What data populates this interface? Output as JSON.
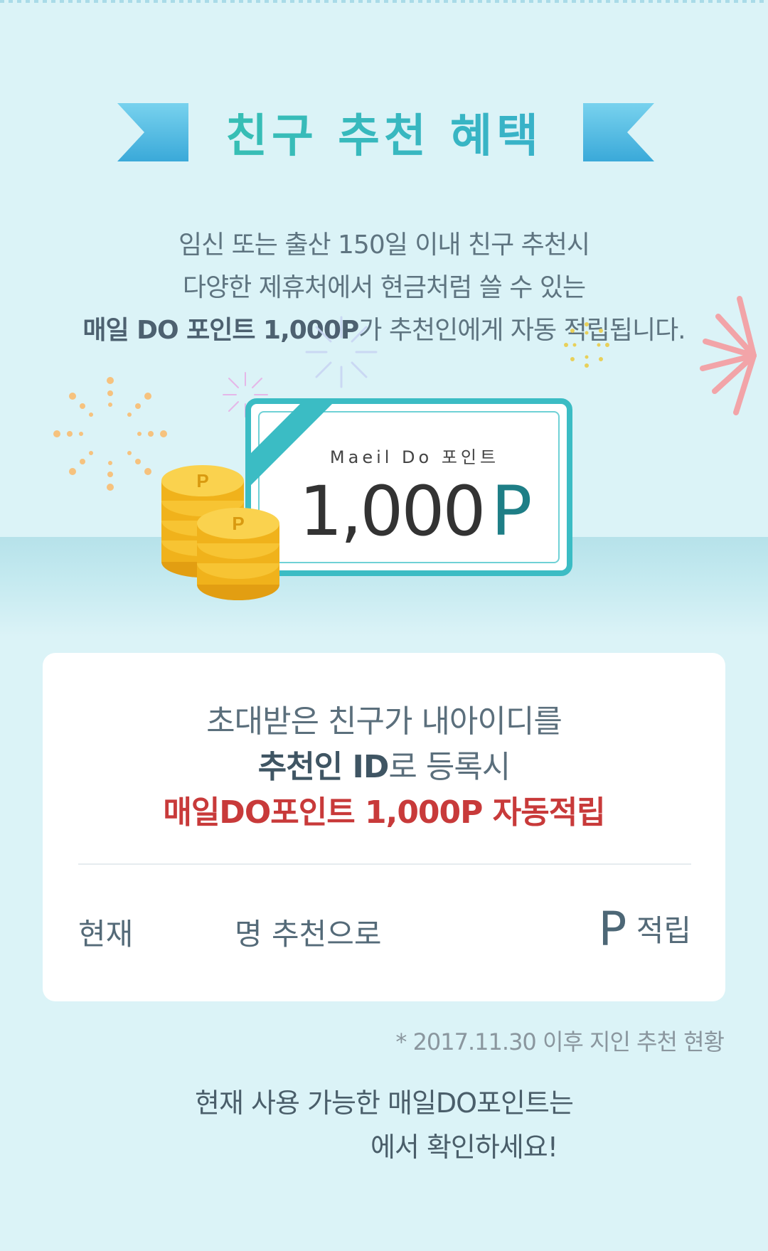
{
  "title": "친구 추천 혜택",
  "intro": {
    "line1": "임신 또는 출산 150일 이내 친구 추천시",
    "line2": "다양한 제휴처에서 현금처럼 쓸 수 있는",
    "line3_bold": "매일 DO 포인트 1,000P",
    "line3_rest": "가 추천인에게 자동 적립됩니다."
  },
  "card": {
    "subtitle": "Maeil Do 포인트",
    "amount": "1,000",
    "unit": "P",
    "coin_mark": "P"
  },
  "benefit_box": {
    "line1": "초대받은 친구가 내아이디를",
    "line2_bold": "추천인 ID",
    "line2_rest": "로 등록시",
    "line3": "매일DO포인트 1,000P 자동적립",
    "status_now": "현재",
    "status_count_suffix": "명 추천으로",
    "status_point_unit": "P",
    "status_point_suffix": "적립"
  },
  "note": "* 2017.11.30 이후 지인 추천 현황",
  "footer": {
    "line1": "현재 사용 가능한 매일DO포인트는",
    "line2": "에서 확인하세요!"
  },
  "colors": {
    "background": "#dbf3f7",
    "title_gradient_start": "#36c7a5",
    "title_gradient_end": "#39a9d8",
    "ribbon": "#4dbde4",
    "card_border": "#3bbcc4",
    "accent_red": "#c83a3a",
    "coin": "#f5b81c"
  },
  "icons": [
    "ribbon-left-icon",
    "ribbon-right-icon",
    "firework-icon",
    "coin-stack-icon",
    "card-corner-ribbon-icon"
  ]
}
